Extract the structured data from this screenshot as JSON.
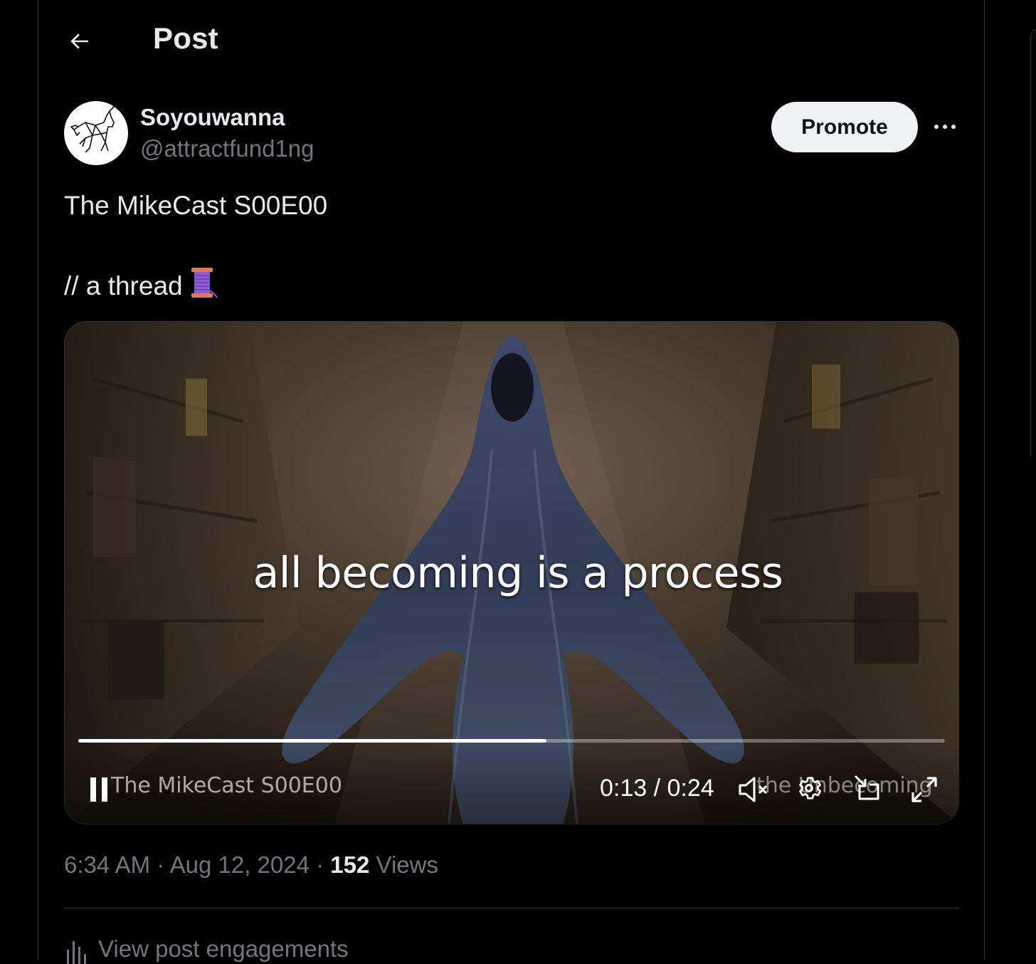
{
  "header": {
    "title": "Post",
    "back_icon": "arrow-left-icon"
  },
  "author": {
    "display_name": "Soyouwanna",
    "handle": "@attractfund1ng",
    "avatar_icon": "unicorn-logo-icon"
  },
  "actions": {
    "promote_label": "Promote",
    "more_icon": "more-horizontal-icon"
  },
  "post": {
    "line1": "The MikeCast S00E00",
    "line2": "// a thread",
    "thread_emoji_icon": "thread-spool-icon"
  },
  "video": {
    "caption": "all becoming is a process",
    "watermark_left": "The MikeCast S00E00",
    "watermark_right": "the Unbecoming",
    "current_time": "0:13",
    "duration": "0:24",
    "time_display": "0:13 / 0:24",
    "progress_fraction": 0.54,
    "controls": {
      "play_pause_icon": "pause-icon",
      "volume_icon": "volume-muted-icon",
      "settings_icon": "gear-icon",
      "pip_icon": "picture-in-picture-icon",
      "fullscreen_icon": "expand-icon"
    }
  },
  "meta": {
    "time": "6:34 AM",
    "separator": "·",
    "date": "Aug 12, 2024",
    "views_count": "152",
    "views_label": "Views"
  },
  "engagements": {
    "label": "View post engagements",
    "icon": "bar-chart-icon"
  },
  "colors": {
    "background": "#000000",
    "text_primary": "#e7e9ea",
    "text_secondary": "#71767b",
    "border": "#2f3336",
    "promote_bg": "#eff3f4"
  }
}
